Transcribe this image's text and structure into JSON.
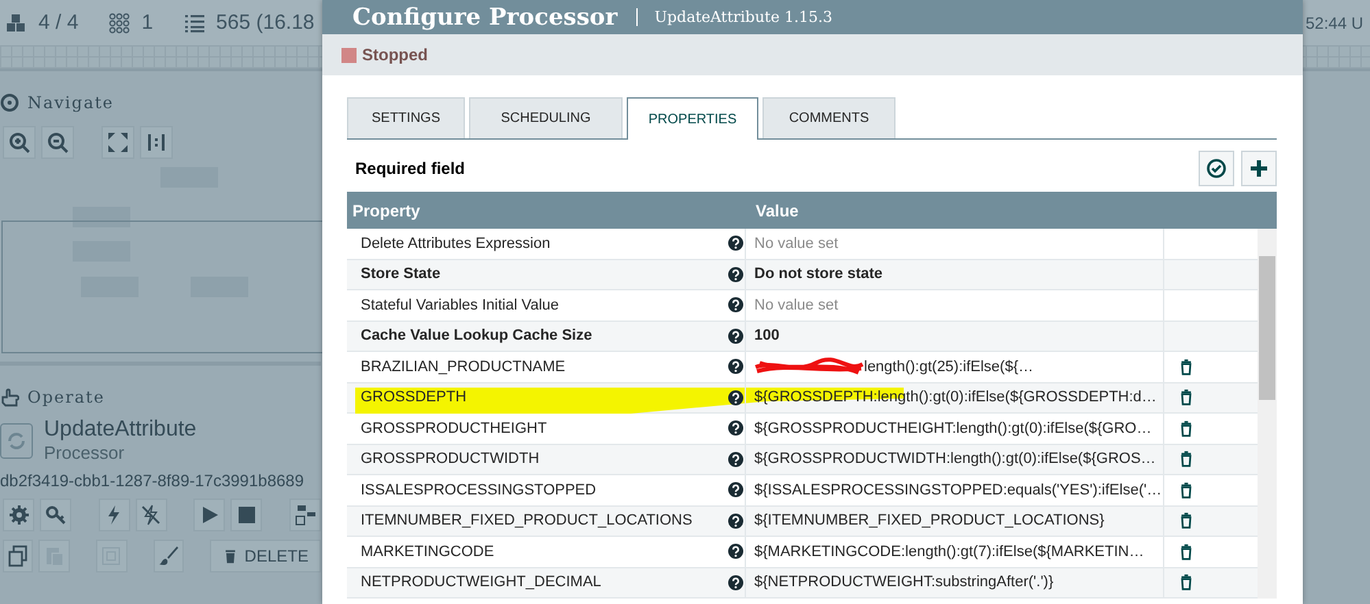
{
  "toolbar": {
    "stats": [
      {
        "kind": "components",
        "text": "4 / 4"
      },
      {
        "kind": "groups",
        "text": "1"
      },
      {
        "kind": "queue",
        "text": "565 (16.18"
      }
    ],
    "time": "52:44 U"
  },
  "navigate": {
    "title": "Navigate"
  },
  "operate": {
    "title": "Operate",
    "component_name": "UpdateAttribute",
    "component_type": "Processor",
    "component_id": "db2f3419-cbb1-1287-8f89-17c3991b8689",
    "delete_label": "DELETE"
  },
  "dialog": {
    "title": "Configure Processor",
    "subtitle": "UpdateAttribute 1.15.3",
    "status": "Stopped",
    "tabs": [
      {
        "label": "SETTINGS",
        "selected": false
      },
      {
        "label": "SCHEDULING",
        "selected": false
      },
      {
        "label": "PROPERTIES",
        "selected": true
      },
      {
        "label": "COMMENTS",
        "selected": false
      }
    ],
    "required_label": "Required field",
    "table": {
      "columns": [
        "Property",
        "Value"
      ],
      "rows": [
        {
          "name": "Delete Attributes Expression",
          "required": false,
          "value": "No value set",
          "value_set": false,
          "redacted": false,
          "deletable": false,
          "highlighted": false
        },
        {
          "name": "Store State",
          "required": true,
          "value": "Do not store state",
          "value_set": true,
          "redacted": false,
          "deletable": false,
          "highlighted": false
        },
        {
          "name": "Stateful Variables Initial Value",
          "required": false,
          "value": "No value set",
          "value_set": false,
          "redacted": false,
          "deletable": false,
          "highlighted": false
        },
        {
          "name": "Cache Value Lookup Cache Size",
          "required": true,
          "value": "100",
          "value_set": true,
          "redacted": false,
          "deletable": false,
          "highlighted": false
        },
        {
          "name": "BRAZILIAN_PRODUCTNAME",
          "required": false,
          "value": "length():gt(25):ifElse(${…",
          "value_set": true,
          "redacted": true,
          "deletable": true,
          "highlighted": false
        },
        {
          "name": "GROSSDEPTH",
          "required": false,
          "value": "${GROSSDEPTH:length():gt(0):ifElse(${GROSSDEPTH:d…",
          "value_set": true,
          "redacted": false,
          "deletable": true,
          "highlighted": true
        },
        {
          "name": "GROSSPRODUCTHEIGHT",
          "required": false,
          "value": "${GROSSPRODUCTHEIGHT:length():gt(0):ifElse(${GRO…",
          "value_set": true,
          "redacted": false,
          "deletable": true,
          "highlighted": false
        },
        {
          "name": "GROSSPRODUCTWIDTH",
          "required": false,
          "value": "${GROSSPRODUCTWIDTH:length():gt(0):ifElse(${GROS…",
          "value_set": true,
          "redacted": false,
          "deletable": true,
          "highlighted": false
        },
        {
          "name": "ISSALESPROCESSINGSTOPPED",
          "required": false,
          "value": "${ISSALESPROCESSINGSTOPPED:equals('YES'):ifElse('…",
          "value_set": true,
          "redacted": false,
          "deletable": true,
          "highlighted": false
        },
        {
          "name": "ITEMNUMBER_FIXED_PRODUCT_LOCATIONS",
          "required": false,
          "value": "${ITEMNUMBER_FIXED_PRODUCT_LOCATIONS}",
          "value_set": true,
          "redacted": false,
          "deletable": true,
          "highlighted": false
        },
        {
          "name": "MARKETINGCODE",
          "required": false,
          "value": "${MARKETINGCODE:length():gt(7):ifElse(${MARKETIN…",
          "value_set": true,
          "redacted": false,
          "deletable": true,
          "highlighted": false
        },
        {
          "name": "NETPRODUCTWEIGHT_DECIMAL",
          "required": false,
          "value": "${NETPRODUCTWEIGHT:substringAfter('.')}",
          "value_set": true,
          "redacted": false,
          "deletable": true,
          "highlighted": false
        }
      ]
    }
  }
}
